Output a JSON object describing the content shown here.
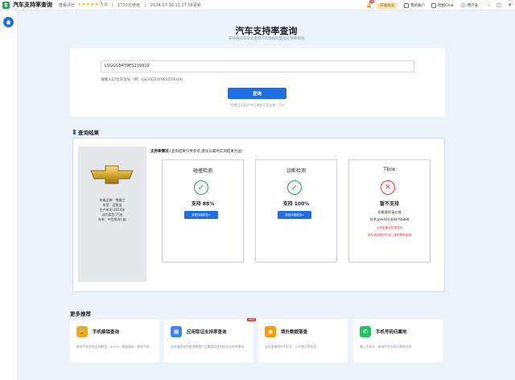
{
  "app": {
    "title": "汽车支持率查询",
    "rating_label": "查看评分",
    "stars": "★★★★★",
    "score": "5.0",
    "users": "1733次使用",
    "updated": "2024-07-30 11:27:56更新",
    "logo_text": "车"
  },
  "topbar_right": {
    "notification_count": "10",
    "vip_label": "开通会员",
    "item1": "我的账户",
    "item2": "轻松Chat",
    "user_name": "用户名"
  },
  "header": {
    "title": "汽车支持率查询",
    "subtitle": "支持通过车架号查询汽车数据的型号支持率情况"
  },
  "search": {
    "vin_value": "LSGGG54Y9ES219319",
    "hint": "请输入17位车架号（例：LSGGG54Y9ES219319）",
    "button_label": "查询",
    "remaining": "免费试用用户今日剩余可用次数：5次"
  },
  "result": {
    "section_title": "查询结果",
    "car_info": {
      "brand": "车辆品牌：雪佛兰",
      "model": "车型：迈锐宝",
      "year": "生产年份:2014年",
      "power": "动力类型:汽油",
      "series": "车系：中型轿车(油)"
    },
    "support_title_bold": "支持率情况",
    "support_title_rest": "-(查询结果仅供参考,建议以最终实测结果为准)",
    "collision": {
      "title": "碰撞检测",
      "value": "支持 88%",
      "button": "查看详细报告>"
    },
    "diagnosis": {
      "title": "诊断检测",
      "value": "支持 100%",
      "button": "查看详细报告>"
    },
    "tbox": {
      "title": "Tbox",
      "value": "暂不支持",
      "line1": "如需要帮请对接",
      "line2": "技术支持400-888-66888",
      "red1": "为提高兼容性请咨询",
      "red2": "联系请用微信扫描二维码联系客服"
    }
  },
  "more": {
    "title": "更多推荐",
    "items": [
      {
        "title": "手机解锁查询",
        "desc": "查询手机状态支持解锁，ROOT，数据备份，刷新手机",
        "icon": "unlock-icon",
        "color": "#f5a623"
      },
      {
        "title": "应用取证支持率查询",
        "desc": "支持通用程序查询数据产品兼容程度的验证支持率情况",
        "icon": "app-icon",
        "color": "#3b82f6",
        "hot": "HOT"
      },
      {
        "title": "境外数据落查",
        "desc": "支持查询境外手机号、APP账号等信息",
        "icon": "globe-icon",
        "color": "#f59e0b"
      },
      {
        "title": "手机号码归属地",
        "desc": "输入手机号，查询手机号码归属地信息",
        "icon": "phone-icon",
        "color": "#22c55e"
      }
    ]
  },
  "colors": {
    "accent": "#1e6fe6",
    "success": "#23a455",
    "danger": "#e53935"
  }
}
